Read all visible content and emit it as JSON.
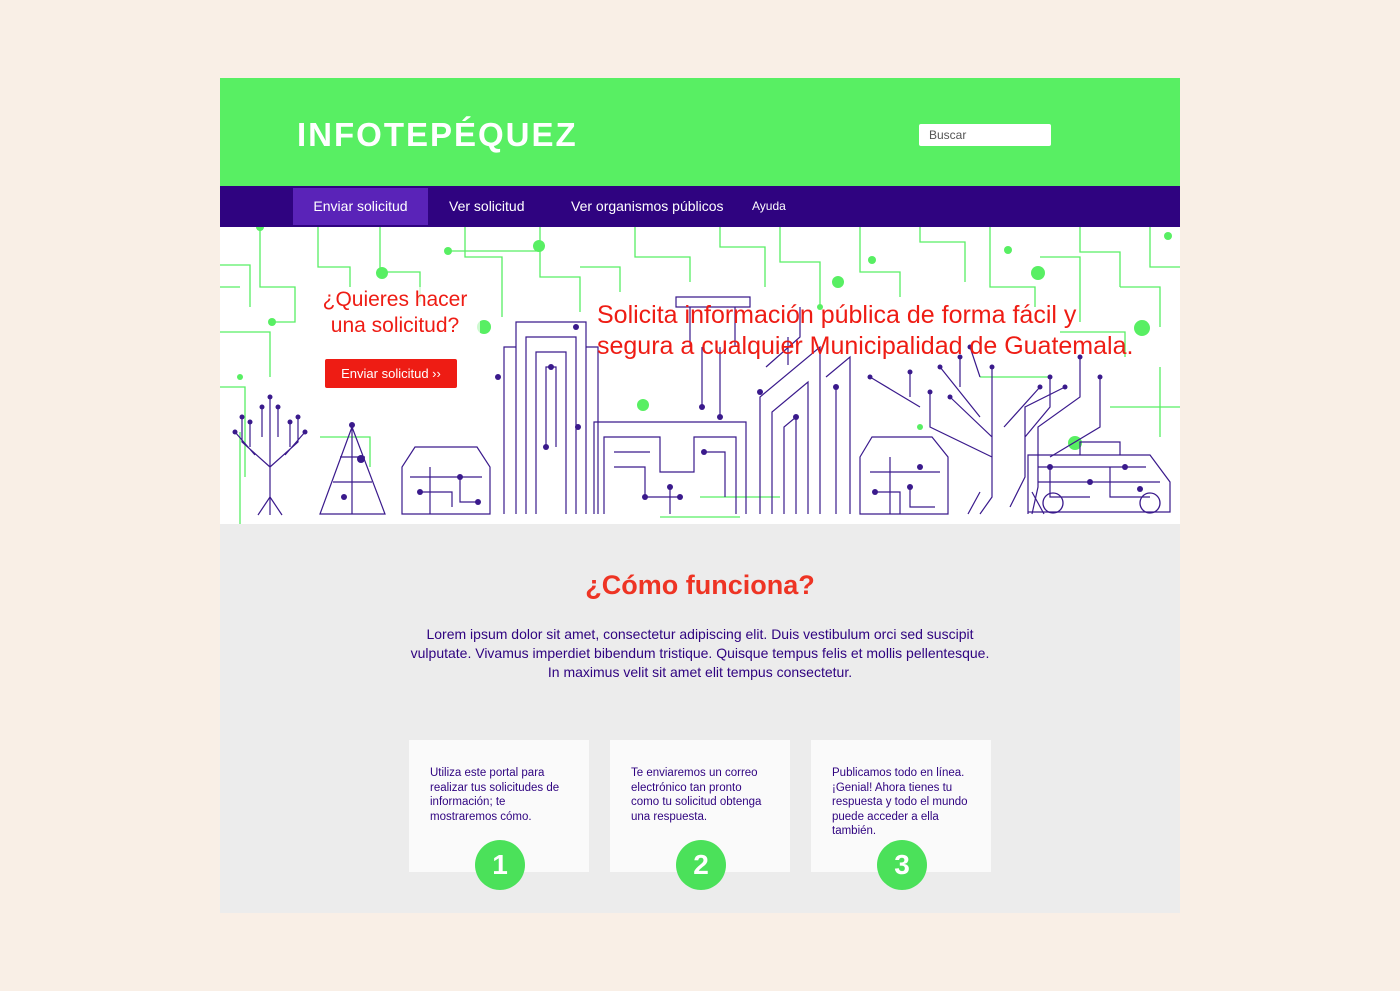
{
  "header": {
    "logo": "INFOTEPÉQUEZ",
    "search_placeholder": "Buscar"
  },
  "nav": {
    "items": [
      {
        "label": "Enviar solicitud",
        "active": true
      },
      {
        "label": "Ver solicitud",
        "active": false
      },
      {
        "label": "Ver organismos públicos",
        "active": false
      },
      {
        "label": "Ayuda",
        "active": false
      }
    ]
  },
  "hero": {
    "question": "¿Quieres hacer una solicitud?",
    "button_label": "Enviar solicitud ››",
    "headline": "Solicita información pública de forma fácil y segura a cualquier Municipalidad de Guatemala."
  },
  "how_it_works": {
    "title": "¿Cómo funciona?",
    "description": "Lorem ipsum dolor sit amet, consectetur adipiscing elit. Duis vestibulum orci sed suscipit vulputate. Vivamus imperdiet bibendum tristique. Quisque tempus felis et mollis pellentesque. In maximus velit sit amet elit tempus consectetur.",
    "steps": [
      {
        "text": "Utiliza este portal para realizar tus solicitudes de información; te mostraremos cómo.",
        "number": "1"
      },
      {
        "text": "Te enviaremos un correo electrónico tan pronto como tu solicitud obtenga una respuesta.",
        "number": "2"
      },
      {
        "text": "Publicamos todo en línea. ¡Genial! Ahora tienes tu respuesta y todo el mundo puede acceder a ella también.",
        "number": "3"
      }
    ]
  },
  "colors": {
    "page_background": "#f9efe6",
    "header_green": "#58ef63",
    "nav_purple": "#2f0380",
    "nav_active": "#5a23b8",
    "accent_red": "#ee1c14",
    "section_gray": "#ececec",
    "step_green": "#4be15a"
  }
}
